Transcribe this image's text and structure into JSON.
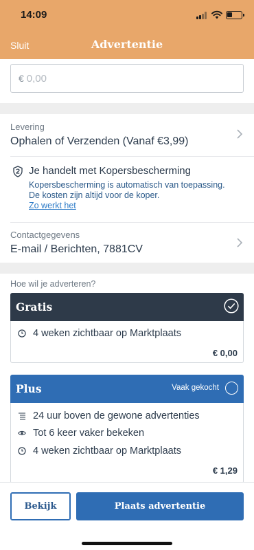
{
  "status_bar": {
    "time": "14:09"
  },
  "nav": {
    "close_label": "Sluit",
    "title": "Advertentie"
  },
  "price": {
    "currency": "€",
    "placeholder": "0,00",
    "value": ""
  },
  "delivery": {
    "label": "Levering",
    "value": "Ophalen of Verzenden (Vanaf  €3,99)"
  },
  "protection": {
    "title": "Je handelt met Kopersbescherming",
    "line1": "Kopersbescherming is automatisch van toepassing.",
    "line2": "De kosten zijn altijd voor de koper.",
    "link": "Zo werkt het"
  },
  "contact": {
    "label": "Contactgegevens",
    "value": "E-mail / Berichten, 7881CV"
  },
  "advertise_question": "Hoe wil je adverteren?",
  "plans": [
    {
      "name": "Gratis",
      "selected": true,
      "badge": "",
      "header_color": "#2e3a49",
      "features": [
        {
          "icon": "clock-icon",
          "text": "4 weken zichtbaar op Marktplaats"
        }
      ],
      "price": "€ 0,00"
    },
    {
      "name": "Plus",
      "selected": false,
      "badge": "Vaak gekocht",
      "header_color": "#2f6db4",
      "features": [
        {
          "icon": "list-up-icon",
          "text": "24 uur boven de gewone advertenties"
        },
        {
          "icon": "eye-icon",
          "text": "Tot 6 keer vaker bekeken"
        },
        {
          "icon": "clock-icon",
          "text": "4 weken zichtbaar op Marktplaats"
        }
      ],
      "price": "€ 1,29"
    }
  ],
  "actions": {
    "preview_label": "Bekijk",
    "place_label": "Plaats advertentie"
  },
  "colors": {
    "header": "#e8a76a",
    "primary_blue": "#2f6db4",
    "dark_header": "#2e3a49",
    "text": "#2d3c4d",
    "link": "#2b7ac7"
  }
}
